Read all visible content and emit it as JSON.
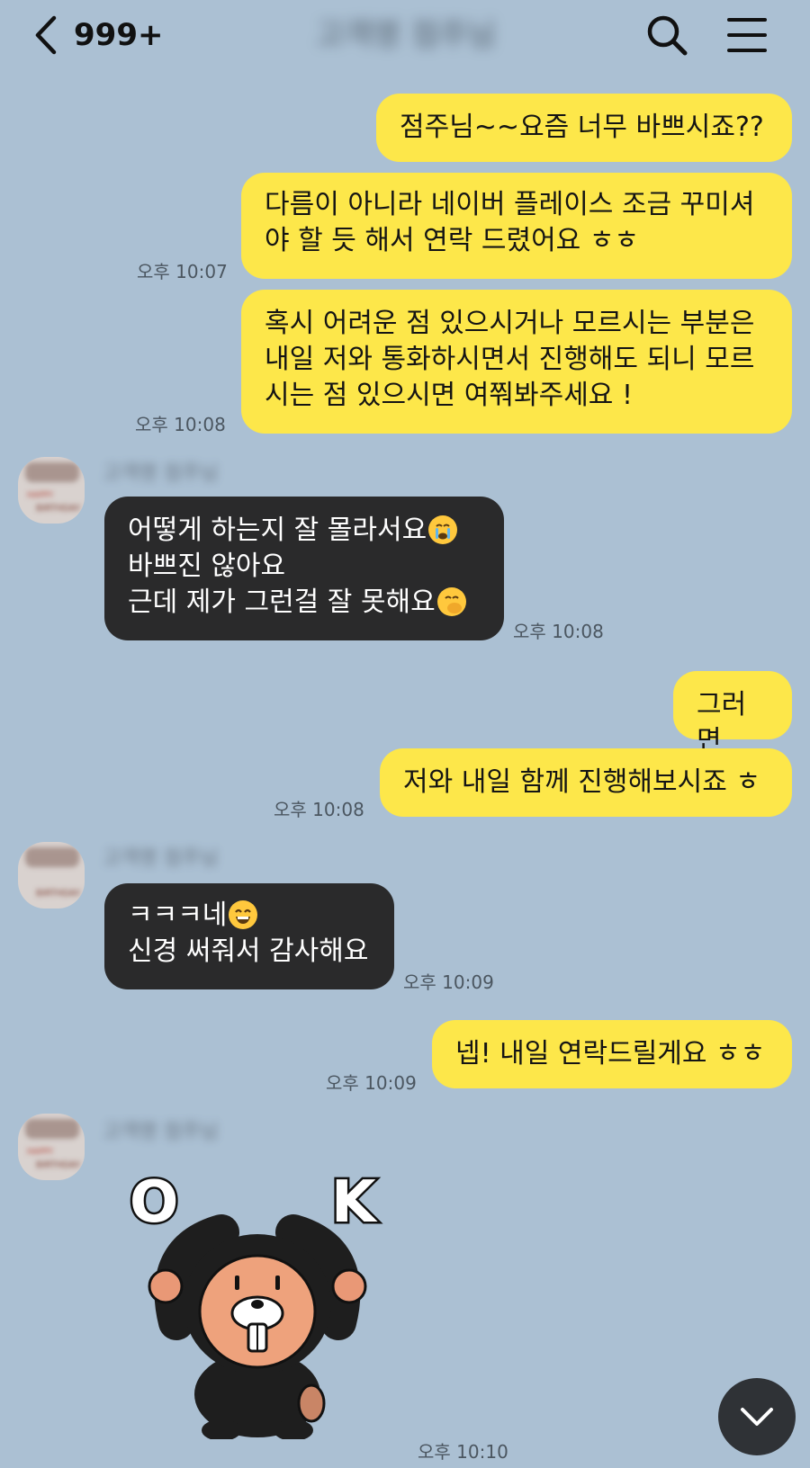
{
  "header": {
    "unread_count": "999+",
    "chat_title": "고객명 점주님"
  },
  "sender": {
    "name": "고객명 점주님",
    "avatar_text_1": "HAPPY",
    "avatar_text_2": "BIRTHDAY"
  },
  "messages": [
    {
      "from": "me",
      "text": "점주님~~요즘 너무 바쁘시죠??",
      "time": ""
    },
    {
      "from": "me",
      "text": "다름이 아니라 네이버 플레이스 조금 꾸미셔\n야 할 듯 해서 연락 드렸어요 ㅎㅎ",
      "time": "오후 10:07"
    },
    {
      "from": "me",
      "text": "혹시 어려운 점 있으시거나 모르시는 부분은\n내일 저와 통화하시면서 진행해도 되니 모르\n시는 점 있으시면 여쭤봐주세요 !",
      "time": "오후 10:08"
    },
    {
      "from": "them",
      "line1": "어떻게 하는지 잘 몰라서요",
      "line2": "바쁘진 않아요",
      "line3": "근데 제가 그런걸 잘 못해요",
      "time": "오후 10:08"
    },
    {
      "from": "me",
      "text": "그러면",
      "time": ""
    },
    {
      "from": "me",
      "text": "저와 내일 함께 진행해보시죠 ㅎ",
      "time": "오후 10:08"
    },
    {
      "from": "them",
      "line1": "ㅋㅋㅋ네",
      "line2": "신경 써줘서 감사해요",
      "time": "오후 10:09"
    },
    {
      "from": "me",
      "text": "넵! 내일 연락드릴게요 ㅎㅎ",
      "time": "오후 10:09"
    },
    {
      "from": "them",
      "sticker_letters_1": "O",
      "sticker_letters_2": "K",
      "time": "오후 10:10"
    }
  ],
  "colors": {
    "background": "#abc0d3",
    "my_bubble": "#fde74a",
    "their_bubble": "#2a2a2b"
  },
  "icons": [
    "back-chevron-icon",
    "search-icon",
    "menu-icon",
    "scroll-down-icon"
  ]
}
